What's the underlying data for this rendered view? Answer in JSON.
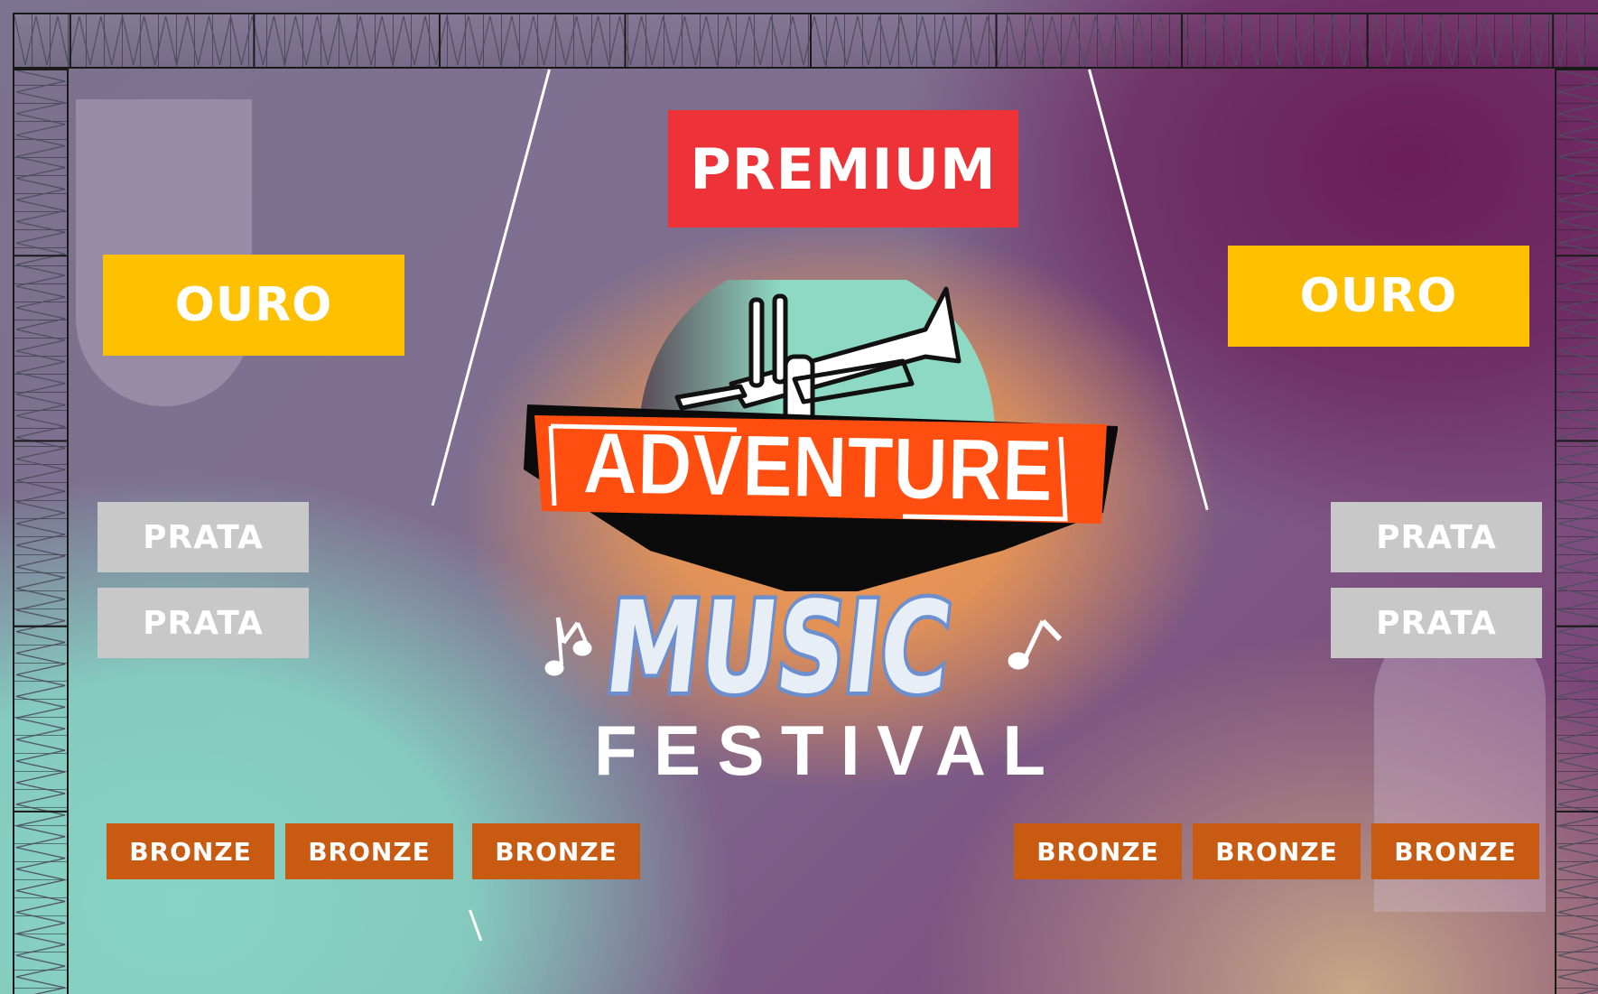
{
  "signs": {
    "premium": "PREMIUM",
    "ouro_left": "OURO",
    "ouro_right": "OURO",
    "prata_left_1": "PRATA",
    "prata_left_2": "PRATA",
    "prata_right_1": "PRATA",
    "prata_right_2": "PRATA",
    "bronze_1": "BRONZE",
    "bronze_2": "BRONZE",
    "bronze_3": "BRONZE",
    "bronze_4": "BRONZE",
    "bronze_5": "BRONZE",
    "bronze_6": "BRONZE"
  },
  "logo": {
    "line1": "ADVENTURE",
    "line2": "MUSIC",
    "line3": "FESTIVAL"
  },
  "colors": {
    "premium": "#ee3338",
    "ouro": "#ffc000",
    "prata": "#c8c8c8",
    "bronze": "#c85a12",
    "logo_banner": "#ff4e0f",
    "logo_disc": "#8ed9c4",
    "music_letters": "#e8eef5"
  },
  "icons": [
    "trumpet-icon",
    "music-note-icon"
  ]
}
